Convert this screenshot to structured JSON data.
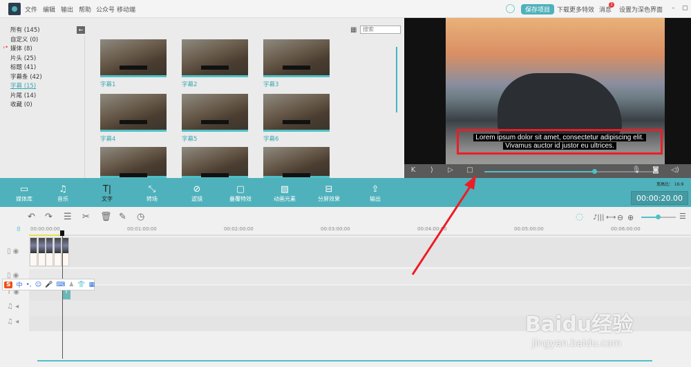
{
  "menu": [
    "文件",
    "编辑",
    "输出",
    "帮助",
    "公众号",
    "移动端"
  ],
  "header": {
    "save": "保存项目",
    "download": "下载更多特效",
    "messages": "消息",
    "message_badge": "1",
    "dark_mode": "设置为深色界面",
    "minimize": "–",
    "maximize": "▢"
  },
  "categories": [
    {
      "label": "所有 (145)"
    },
    {
      "label": "自定义 (0)"
    },
    {
      "label": "媒体 (8)"
    },
    {
      "label": "片头 (25)"
    },
    {
      "label": "标题 (41)"
    },
    {
      "label": "字幕条 (42)"
    },
    {
      "label": "字幕 (15)",
      "active": true
    },
    {
      "label": "片尾 (14)"
    },
    {
      "label": "收藏 (0)"
    }
  ],
  "search": {
    "placeholder": "搜索"
  },
  "thumbs": [
    "字幕1",
    "字幕2",
    "字幕3",
    "字幕4",
    "字幕5",
    "字幕6",
    "",
    "",
    ""
  ],
  "preview": {
    "subtitle_line1": "Lorem ipsum dolor sit amet, consectetur adipiscing elit.",
    "subtitle_line2": "Vivamus auctor id justor eu ultrices.",
    "progress": 0.65
  },
  "toolbar": [
    "媒体库",
    "音乐",
    "文字",
    "转场",
    "滤镜",
    "叠覆特效",
    "动画元素",
    "分屏效果",
    "输出"
  ],
  "aspect_ratio": "宽高比： 16:9",
  "duration": "00:00:20.00",
  "ruler": [
    "00:00:00:00",
    "00:01:00:00",
    "00:02:00:00",
    "00:03:00:00",
    "00:04:00:00",
    "00:05:00:00",
    "00:06:00:00"
  ],
  "ime": {
    "logo": "S",
    "mode": "中"
  },
  "watermark": {
    "brand": "Baidu经验",
    "url": "jingyan.baidu.com"
  },
  "colors": {
    "accent": "#4fb1bb",
    "highlight": "#ee1c25"
  }
}
